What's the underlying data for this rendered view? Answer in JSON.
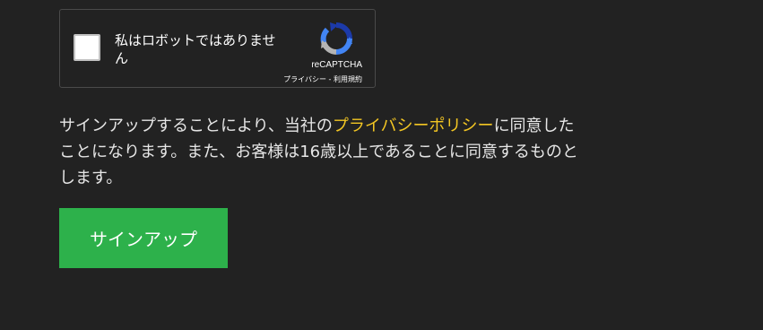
{
  "recaptcha": {
    "checkbox_label": "私はロボットではありません",
    "brand": "reCAPTCHA",
    "privacy_link": "プライバシー",
    "separator": " - ",
    "terms_link": "利用規約",
    "logo_icon": "recaptcha-logo-icon"
  },
  "consent": {
    "text_before": "サインアップすることにより、当社の",
    "privacy_policy_link": "プライバシーポリシー",
    "text_after": "に同意したことになります。また、お客様は16歳以上であることに同意するものとします。",
    "link_color": "#f3c623"
  },
  "signup_button": {
    "label": "サインアップ",
    "color": "#2db14b"
  }
}
